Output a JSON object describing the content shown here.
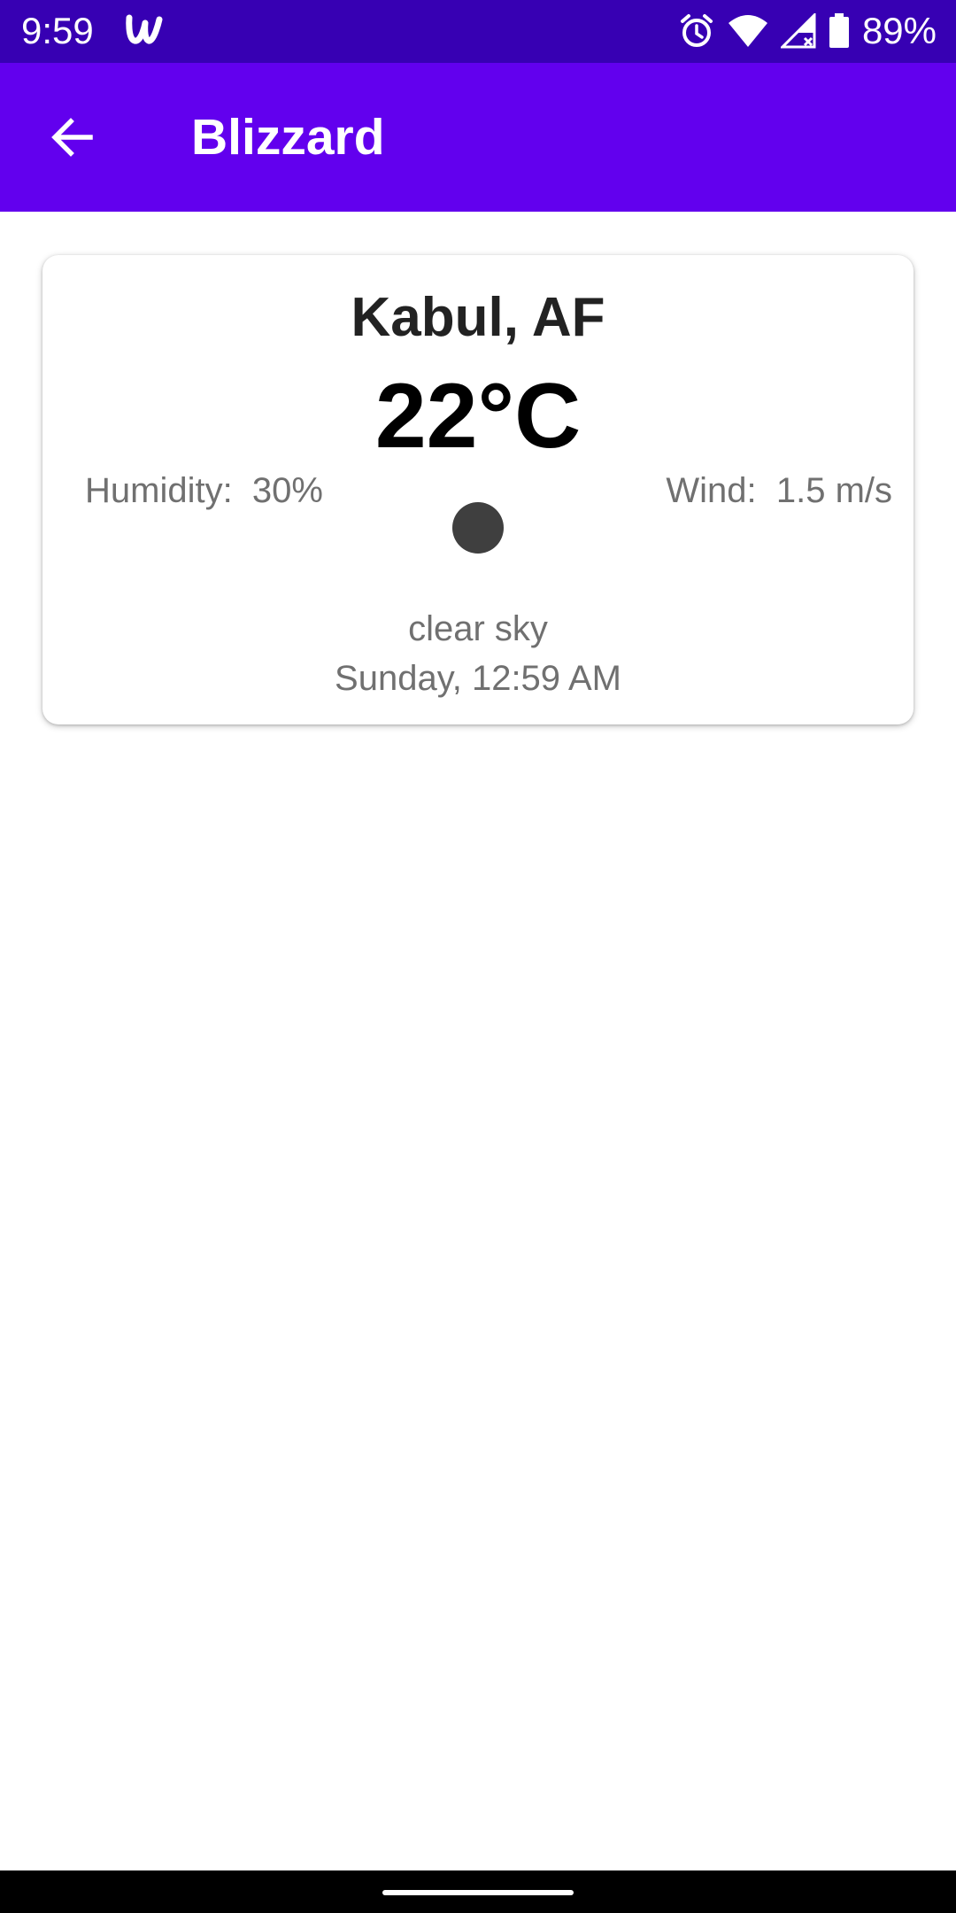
{
  "status_bar": {
    "time": "9:59",
    "battery": "89%",
    "icons": [
      "app-notification-icon",
      "alarm-icon",
      "wifi-icon",
      "cell-signal-icon",
      "battery-icon"
    ],
    "background_color": "#3700b3"
  },
  "app_bar": {
    "title": "Blizzard",
    "back_icon": "arrow-back-icon",
    "background_color": "#6200ee"
  },
  "weather_card": {
    "city": "Kabul, AF",
    "temperature": "22°C",
    "humidity": "Humidity:  30%",
    "wind": "Wind:  1.5 m/s",
    "icon": "weather-icon",
    "description": "clear sky",
    "datetime": "Sunday, 12:59 AM"
  }
}
